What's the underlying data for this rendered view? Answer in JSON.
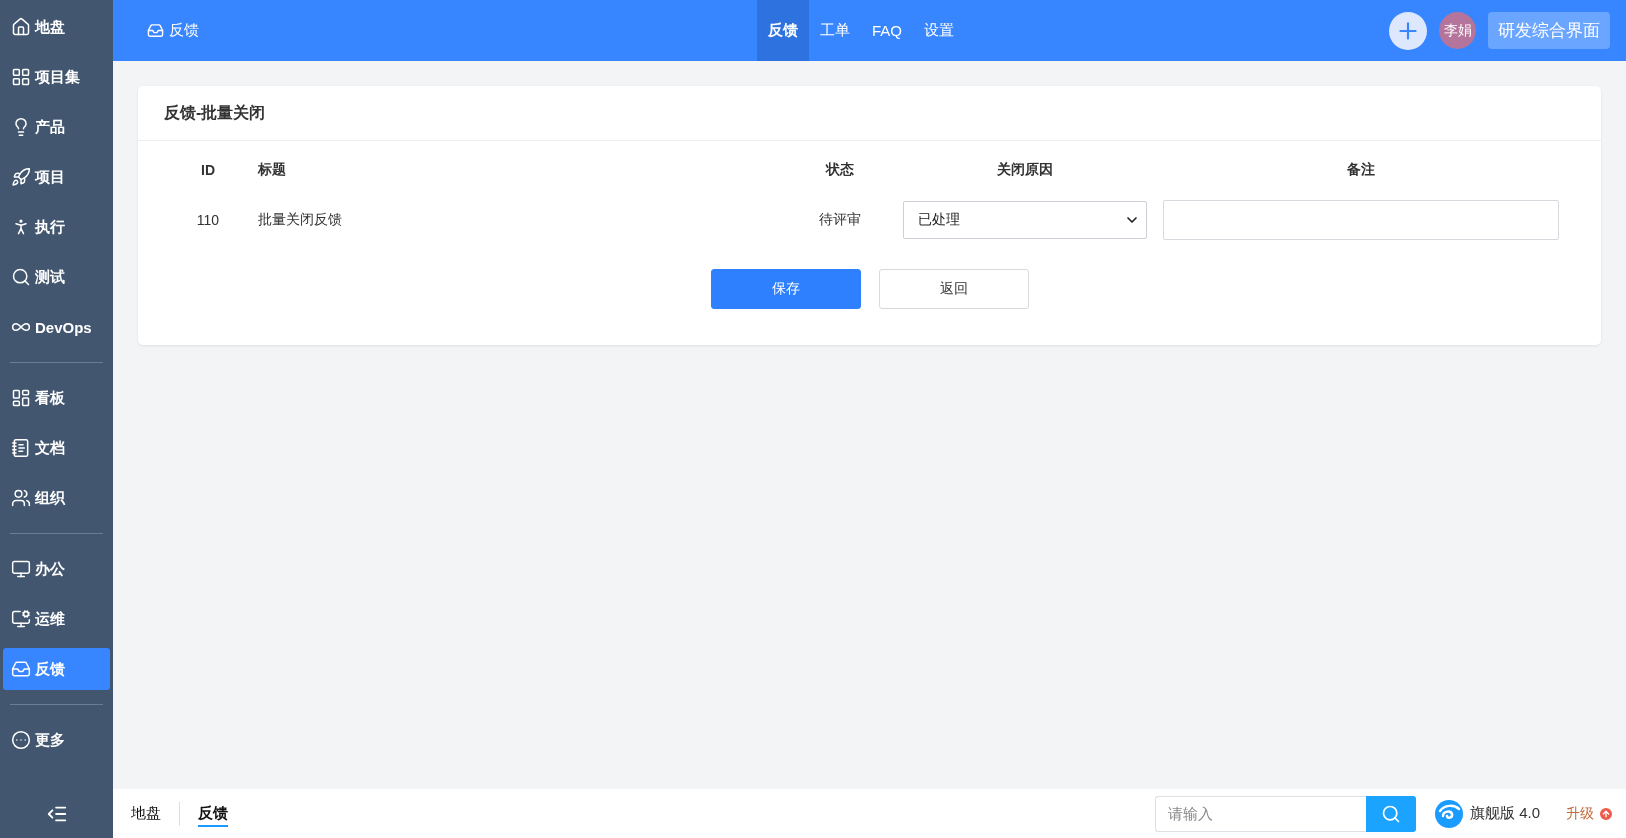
{
  "sidebar": {
    "groups": [
      {
        "items": [
          {
            "label": "地盘",
            "selected": false
          },
          {
            "label": "项目集",
            "selected": false
          },
          {
            "label": "产品",
            "selected": false
          },
          {
            "label": "项目",
            "selected": false
          },
          {
            "label": "执行",
            "selected": false
          },
          {
            "label": "测试",
            "selected": false
          },
          {
            "label": "DevOps",
            "selected": false
          }
        ]
      },
      {
        "items": [
          {
            "label": "看板",
            "selected": false
          },
          {
            "label": "文档",
            "selected": false
          },
          {
            "label": "组织",
            "selected": false
          }
        ]
      },
      {
        "items": [
          {
            "label": "办公",
            "selected": false
          },
          {
            "label": "运维",
            "selected": false
          },
          {
            "label": "反馈",
            "selected": true
          }
        ]
      },
      {
        "items": [
          {
            "label": "更多",
            "selected": false
          }
        ]
      }
    ]
  },
  "header": {
    "module": "反馈",
    "nav": [
      {
        "label": "反馈",
        "selected": true
      },
      {
        "label": "工单",
        "selected": false
      },
      {
        "label": "FAQ",
        "selected": false
      },
      {
        "label": "设置",
        "selected": false
      }
    ],
    "avatar": "李娟",
    "switcher": "研发综合界面"
  },
  "card": {
    "title": "反馈-批量关闭",
    "columns": [
      "ID",
      "标题",
      "状态",
      "关闭原因",
      "备注"
    ],
    "rows": [
      {
        "id": "110",
        "title": "批量关闭反馈",
        "status": "待评审",
        "reason": "已处理"
      }
    ],
    "buttons": [
      {
        "label": "保存",
        "kind": "primary"
      },
      {
        "label": "返回",
        "kind": "default"
      }
    ]
  },
  "footer": {
    "breadcrumbs": [
      {
        "label": "地盘",
        "selected": false
      },
      {
        "label": "反馈",
        "selected": true
      }
    ],
    "search": {
      "placeholder": "请输入"
    },
    "edition": "旗舰版 4.0",
    "upgrade": "升级"
  }
}
